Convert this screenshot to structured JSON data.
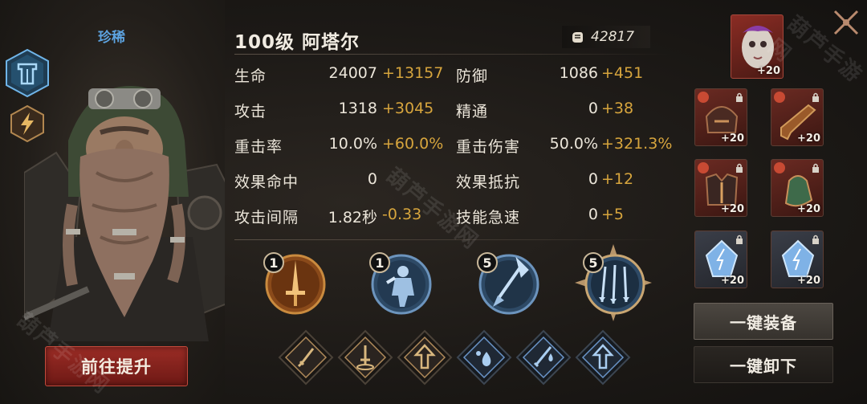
{
  "hero": {
    "rarity": "珍稀",
    "title": "100级  阿塔尔",
    "power": "42817"
  },
  "stats": [
    {
      "name": "生命",
      "base": "24007",
      "bonus": "+13157"
    },
    {
      "name": "防御",
      "base": "1086",
      "bonus": "+451"
    },
    {
      "name": "攻击",
      "base": "1318",
      "bonus": "+3045"
    },
    {
      "name": "精通",
      "base": "0",
      "bonus": "+38"
    },
    {
      "name": "重击率",
      "base": "10.0%",
      "bonus": "+60.0%"
    },
    {
      "name": "重击伤害",
      "base": "50.0%",
      "bonus": "+321.3%"
    },
    {
      "name": "效果命中",
      "base": "0",
      "bonus": ""
    },
    {
      "name": "效果抵抗",
      "base": "0",
      "bonus": "+12"
    },
    {
      "name": "攻击间隔",
      "base": "1.82秒",
      "bonus": "-0.33"
    },
    {
      "name": "技能急速",
      "base": "0",
      "bonus": "+5"
    }
  ],
  "skills": [
    {
      "level": "1",
      "icon": "sword-skill-icon"
    },
    {
      "level": "1",
      "icon": "warrior-skill-icon"
    },
    {
      "level": "5",
      "icon": "spear-skill-icon"
    },
    {
      "level": "5",
      "icon": "arrows-skill-icon"
    }
  ],
  "gems": [
    {
      "icon": "sword-gem-icon",
      "color": "#b08a5a"
    },
    {
      "icon": "dagger-gem-icon",
      "color": "#b08a5a"
    },
    {
      "icon": "up-arrow-gem-icon",
      "color": "#b08a5a"
    },
    {
      "icon": "drops-gem-icon",
      "color": "#6a95c9"
    },
    {
      "icon": "blade-drop-gem-icon",
      "color": "#6a95c9"
    },
    {
      "icon": "up-arrow-blue-gem-icon",
      "color": "#6a95c9"
    }
  ],
  "equipment": {
    "mask_level": "+20",
    "slots": [
      {
        "name": "helmet",
        "level": "+20"
      },
      {
        "name": "gun",
        "level": "+20"
      },
      {
        "name": "armor",
        "level": "+20"
      },
      {
        "name": "gauntlet",
        "level": "+20"
      },
      {
        "name": "crystal-1",
        "level": "+20"
      },
      {
        "name": "crystal-2",
        "level": "+20"
      }
    ]
  },
  "buttons": {
    "upgrade": "前往提升",
    "equip_all": "一键装备",
    "remove_all": "一键卸下"
  },
  "watermark": "葫芦手游网",
  "colors": {
    "accent_gold": "#d7a53d",
    "rarity_blue": "#5da3e0",
    "button_red": "#9b2c25"
  }
}
